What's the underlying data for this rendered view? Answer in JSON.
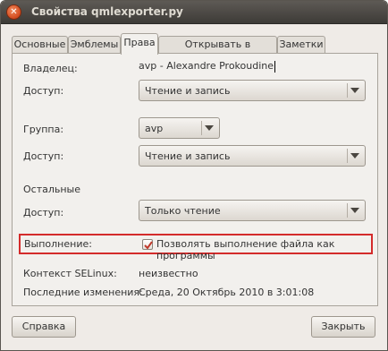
{
  "window": {
    "title": "Свойства qmlexporter.py"
  },
  "tabs": [
    {
      "label": "Основные",
      "active": false
    },
    {
      "label": "Эмблемы",
      "active": false
    },
    {
      "label": "Права",
      "active": true
    },
    {
      "label": "Открывать в программе",
      "active": false
    },
    {
      "label": "Заметки",
      "active": false
    }
  ],
  "owner": {
    "label": "Владелец:",
    "value": "avp - Alexandre Prokoudine"
  },
  "owner_access": {
    "label": "Доступ:",
    "value": "Чтение и запись"
  },
  "group": {
    "label": "Группа:",
    "value": "avp"
  },
  "group_access": {
    "label": "Доступ:",
    "value": "Чтение и запись"
  },
  "others": {
    "label": "Остальные"
  },
  "others_access": {
    "label": "Доступ:",
    "value": "Только чтение"
  },
  "execute": {
    "label": "Выполнение:",
    "checkbox_label": "Позволять выполнение файла как программы",
    "checked": true
  },
  "selinux": {
    "label": "Контекст SELinux:",
    "value": "неизвестно"
  },
  "modified": {
    "label": "Последние изменения:",
    "value": "Среда, 20 Октябрь 2010 в 3:01:08"
  },
  "buttons": {
    "help": "Справка",
    "close": "Закрыть"
  },
  "colors": {
    "highlight": "#d42b2b",
    "checkmark": "#c0392b",
    "titlebar": "#3d3b37"
  }
}
